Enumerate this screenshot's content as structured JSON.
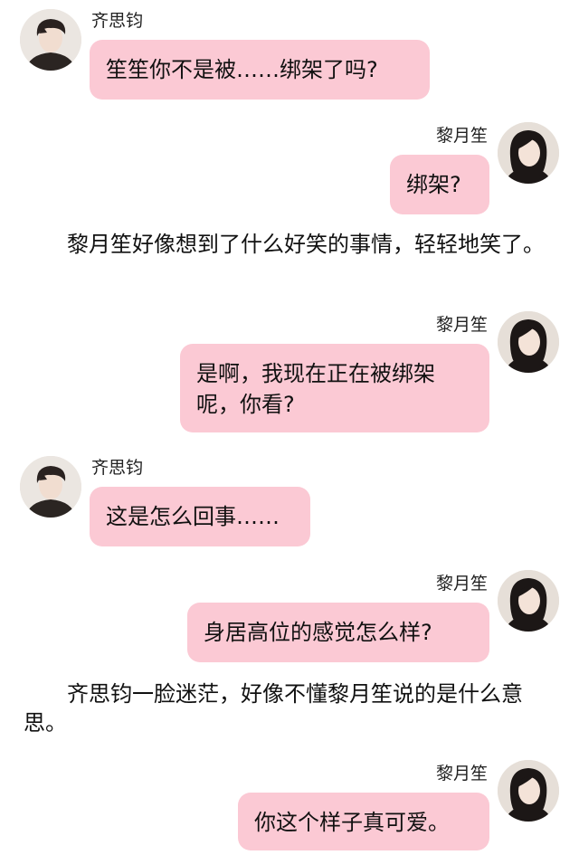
{
  "characters": {
    "male": {
      "name": "齐思钧",
      "avatar_icon": "male-portrait-avatar",
      "color": "#2b2522"
    },
    "female": {
      "name": "黎月笙",
      "avatar_icon": "female-portrait-avatar",
      "color": "#1c1716"
    }
  },
  "bubble_color": "#fbc9d4",
  "messages": [
    {
      "speaker": "齐思钧",
      "side": "left",
      "text": "笙笙你不是被……绑架了吗?"
    },
    {
      "speaker": "黎月笙",
      "side": "right",
      "text": "绑架?"
    },
    {
      "narration": "黎月笙好像想到了什么好笑的事情，轻轻地笑了。"
    },
    {
      "speaker": "黎月笙",
      "side": "right",
      "text": "是啊，我现在正在被绑架呢，你看?"
    },
    {
      "speaker": "齐思钧",
      "side": "left",
      "text": "这是怎么回事……"
    },
    {
      "speaker": "黎月笙",
      "side": "right",
      "text": "身居高位的感觉怎么样?"
    },
    {
      "narration": "齐思钧一脸迷茫，好像不懂黎月笙说的是什么意思。"
    },
    {
      "speaker": "黎月笙",
      "side": "right",
      "text": "你这个样子真可爱。"
    }
  ]
}
